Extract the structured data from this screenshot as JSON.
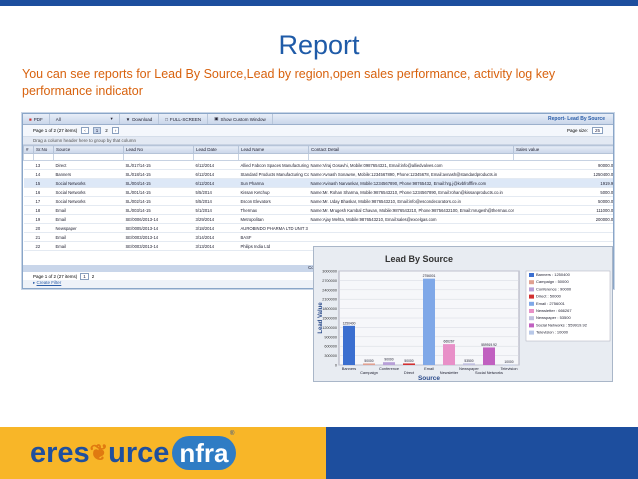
{
  "slide": {
    "title": "Report",
    "subtitle": "You can see  reports for Lead By Source,Lead by region,open sales performance, activity log key performance indicator"
  },
  "toolbar": {
    "items": [
      "PDF",
      "All",
      "Download",
      "FULL-SCREEN",
      "Show Custom Window"
    ],
    "title": "Report- Lead By Source"
  },
  "grid": {
    "page_info": "Page 1 of 2 (27 items)",
    "pages": [
      "1",
      "2"
    ],
    "page_size_label": "Page size:",
    "page_size": "25",
    "group_hint": "Drag a column header here to group by that column",
    "columns": [
      "#",
      "Sr.No",
      "Source",
      "Lead No",
      "Lead Date",
      "Lead Name",
      "Contact Detail",
      "Sales value"
    ],
    "rows": [
      [
        "",
        "13",
        "Direct",
        "SL/017/14-15",
        "6/12/2014",
        "Allied Fabcon Spaces Manufacturing Co.",
        "Name:Viraj Gosavhi, Mobile:0987654321, Email:info@alliedvalves.com",
        "90000.00"
      ],
      [
        "",
        "14",
        "Banners",
        "SL/018/14-15",
        "6/12/2014",
        "Standard Products Manufacturing Co",
        "Name:Avnash Sonawne, Mobile:1234567890, Phone:12345678, Email:avnash@standardproducts.in",
        "1250400.00"
      ],
      [
        "",
        "15",
        "Social Networks",
        "SL/004/14-15",
        "6/12/2014",
        "Sun Pharma",
        "Name:Avinash Narvankar, Mobile:1234567890, Phone:98765432, Email:hrg.j@kvbfrofffire.com",
        "1919.92"
      ],
      [
        "",
        "16",
        "Social Networks",
        "SL/001/14-15",
        "5/5/2014",
        "Kissan Ketchup",
        "Name:Mr. Rohan Sharma, Mobile:9876543210, Phone:1234567890, Email:rohan@kissanproducts.co.in",
        "5000.00"
      ],
      [
        "",
        "17",
        "Social Networks",
        "SL/002/14-15",
        "5/5/2014",
        "Escon Elevators",
        "Name:Mr. Uday Bhaskar, Mobile:9876543210, Email:info@escondecorators.co.in",
        "50000.00"
      ],
      [
        "",
        "18",
        "Email",
        "SL/003/14-15",
        "5/1/2014",
        "Thermax",
        "Name:Mr. Mrugesh Kambal Chavan, Mobile:9876543210, Phone:98756432100, Email:mrugesh@thermax.com",
        "111000.00"
      ],
      [
        "",
        "19",
        "Email",
        "SE/0006/2013-14",
        "3/29/2014",
        "Metropolitan",
        "Name:Ajay Mehta, Mobile:9876543210, Email:sales@excelgas.com",
        "200000.00"
      ],
      [
        "",
        "20",
        "Newspaper",
        "SE/0005/2013-14",
        "3/18/2014",
        "AUROBINDO PHARMA LTD UNIT 3",
        "",
        ""
      ],
      [
        "",
        "21",
        "Email",
        "SE/0003/2013-14",
        "3/14/2014",
        "BASF",
        "",
        ""
      ],
      [
        "",
        "22",
        "Email",
        "SE/0003/2013-14",
        "3/13/2014",
        "Philips India Ltd",
        "",
        ""
      ]
    ],
    "count": "Count=27",
    "create_filter": "Create Filter"
  },
  "chart_data": {
    "type": "bar",
    "title": "Lead By Source",
    "xlabel": "Source",
    "ylabel": "Lead Value",
    "categories": [
      "Banners",
      "Campaign",
      "Conference",
      "Direct",
      "Email",
      "Newsletter",
      "Newspaper",
      "Social Networks",
      "Television"
    ],
    "values": [
      1250400,
      50000,
      90000,
      50000,
      2756001,
      666267,
      53500,
      559919.92,
      10000
    ],
    "data_labels": [
      "1250400",
      "50000",
      "90000",
      "50000",
      "2756001",
      "666267",
      "53500",
      "559919.92",
      "10000"
    ],
    "ylim": [
      0,
      3000000
    ],
    "yticks": [
      "0",
      "300000",
      "600000",
      "900000",
      "1200000",
      "1500000",
      "1800000",
      "2100000",
      "2400000",
      "2700000",
      "3000000"
    ],
    "legend": [
      "Banners : 1250400",
      "Campaign : 50000",
      "Conference : 90000",
      "Direct : 50000",
      "Email : 2756001",
      "Newsletter : 666267",
      "Newspaper : 53500",
      "Social Networks : 559919.92",
      "Television : 10000"
    ],
    "colors": [
      "#3b6fd0",
      "#e0a090",
      "#b8a0d8",
      "#d23030",
      "#7fa8e8",
      "#e890c8",
      "#c0c0e0",
      "#c060c0",
      "#b8c8e8"
    ]
  },
  "brand": {
    "name_part1": "eres",
    "name_part2": "urce",
    "name_part3": "nfra",
    "reg": "®",
    "colors": {
      "blue": "#1d4e9e",
      "orange": "#f8b628"
    }
  }
}
